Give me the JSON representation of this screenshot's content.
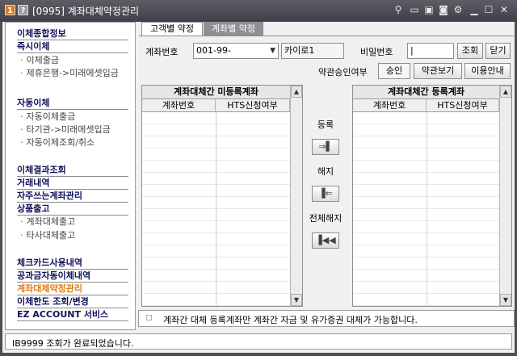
{
  "titlebar": {
    "badge1": "1",
    "badge2": "?",
    "title": "[0995] 계좌대체약정관리",
    "icons": [
      "link-icon",
      "screen-icon",
      "copy-icon",
      "camera-icon",
      "gear-icon",
      "minimize-icon",
      "maximize-icon",
      "close-icon"
    ]
  },
  "sidebar": {
    "items": [
      {
        "label": "이체종합정보",
        "kind": "header"
      },
      {
        "label": "즉시이체",
        "kind": "header"
      },
      {
        "label": "이체출금",
        "kind": "sub"
      },
      {
        "label": "제휴은행->미래에셋입금",
        "kind": "sub"
      },
      {
        "label": "자동이체",
        "kind": "header"
      },
      {
        "label": "자동이체출금",
        "kind": "sub"
      },
      {
        "label": "타기관->미래에셋입금",
        "kind": "sub"
      },
      {
        "label": "자동이체조회/취소",
        "kind": "sub"
      },
      {
        "label": "이체결과조회",
        "kind": "header"
      },
      {
        "label": "거래내역",
        "kind": "header"
      },
      {
        "label": "자주쓰는계좌관리",
        "kind": "header"
      },
      {
        "label": "상품출고",
        "kind": "header"
      },
      {
        "label": "계좌대체출고",
        "kind": "sub"
      },
      {
        "label": "타사대체출고",
        "kind": "sub"
      },
      {
        "label": "체크카드사용내역",
        "kind": "header"
      },
      {
        "label": "공과금자동이체내역",
        "kind": "header"
      },
      {
        "label": "계좌대체약정관리",
        "kind": "active"
      },
      {
        "label": "이체한도 조회/변경",
        "kind": "header"
      },
      {
        "label": "EZ ACCOUNT 서비스",
        "kind": "header"
      }
    ]
  },
  "tabs": {
    "tab1": "고객별 약정",
    "tab2": "계좌별 약정"
  },
  "form": {
    "account_label": "계좌번호",
    "account_value": "001-99-",
    "account_name": "카이로1",
    "password_label": "비밀번호",
    "password_value": "|",
    "query_button": "조회",
    "close_button": "닫기",
    "consent_label": "약관승인여부",
    "consent_value": "승인",
    "terms_button": "약관보기",
    "guide_button": "이용안내"
  },
  "left_grid": {
    "title": "계좌대체간 미등록계좌",
    "columns": [
      "계좌번호",
      "HTS신청여부"
    ]
  },
  "right_grid": {
    "title": "계좌대체간 등록계좌",
    "columns": [
      "계좌번호",
      "HTS신청여부"
    ]
  },
  "middle": {
    "register_label": "등록",
    "register_button": "⇒▌",
    "cancel_label": "해지",
    "cancel_button": "▐⇐",
    "cancel_all_label": "전체해지",
    "cancel_all_button": "▐◀◀"
  },
  "notice": {
    "icon": "bullet-icon",
    "text": "계좌간 대체 등록계좌만 계좌간 자금 및 유가증권 대체가 가능합니다."
  },
  "status": {
    "text": "IB9999  조회가 완료되었습니다."
  },
  "colors": {
    "accent": "#e07b12",
    "header_text": "#11115a",
    "title_bar": "#4d4d55"
  }
}
